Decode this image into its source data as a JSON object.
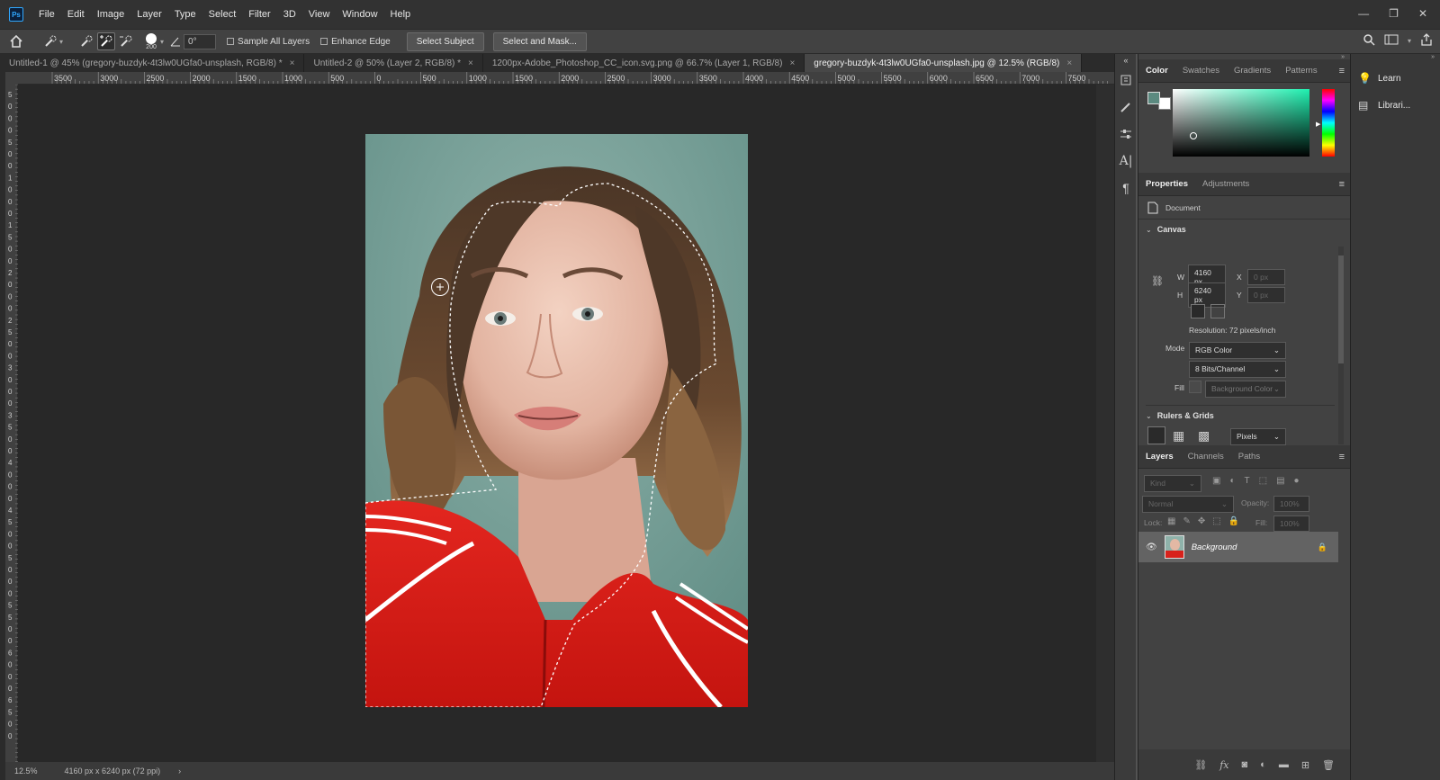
{
  "app": {
    "logo": "Ps"
  },
  "menu": [
    "File",
    "Edit",
    "Image",
    "Layer",
    "Type",
    "Select",
    "Filter",
    "3D",
    "View",
    "Window",
    "Help"
  ],
  "window_controls": {
    "minimize": "—",
    "restore": "❐",
    "close": "✕"
  },
  "options": {
    "brush_size": "200",
    "angle": "0°",
    "sample_all_layers": "Sample All Layers",
    "enhance_edge": "Enhance Edge",
    "select_subject": "Select Subject",
    "select_and_mask": "Select and Mask..."
  },
  "tabs": [
    {
      "label": "Untitled-1 @ 45% (gregory-buzdyk-4t3lw0UGfa0-unsplash, RGB/8) *",
      "close": "×"
    },
    {
      "label": "Untitled-2 @ 50% (Layer 2, RGB/8) *",
      "close": "×"
    },
    {
      "label": "1200px-Adobe_Photoshop_CC_icon.svg.png @ 66.7% (Layer 1, RGB/8)",
      "close": "×"
    },
    {
      "label": "gregory-buzdyk-4t3lw0UGfa0-unsplash.jpg @ 12.5% (RGB/8)",
      "close": "×"
    }
  ],
  "ruler": {
    "h_labels": [
      "3500",
      "3000",
      "2500",
      "2000",
      "1500",
      "1000",
      "500",
      "0",
      "500",
      "1000",
      "1500",
      "2000",
      "2500",
      "3000",
      "3500",
      "4000",
      "4500",
      "5000",
      "5500",
      "6000",
      "6500",
      "7000",
      "7500"
    ],
    "v_labels": [
      "5",
      "0",
      "0",
      "0",
      "5",
      "0",
      "0",
      "1",
      "0",
      "0",
      "0",
      "1",
      "5",
      "0",
      "0",
      "2",
      "0",
      "0",
      "0",
      "2",
      "5",
      "0",
      "0",
      "3",
      "0",
      "0",
      "0",
      "3",
      "5",
      "0",
      "0",
      "4",
      "0",
      "0",
      "0",
      "4",
      "5",
      "0",
      "0",
      "5",
      "0",
      "0",
      "0",
      "5",
      "5",
      "0",
      "0",
      "6",
      "0",
      "0",
      "0",
      "6",
      "5",
      "0",
      "0"
    ]
  },
  "status": {
    "zoom": "12.5%",
    "doc_size": "4160 px x 6240 px (72 ppi)"
  },
  "color_panel": {
    "tabs": [
      "Color",
      "Swatches",
      "Gradients",
      "Patterns"
    ],
    "active": "Color",
    "foreground": "#5c8a80",
    "background": "#ffffff"
  },
  "properties": {
    "tabs": [
      "Properties",
      "Adjustments"
    ],
    "doc_label": "Document",
    "canvas_section": "Canvas",
    "w_label": "W",
    "w_value": "4160 px",
    "h_label": "H",
    "h_value": "6240 px",
    "x_label": "X",
    "x_value": "0 px",
    "y_label": "Y",
    "y_value": "0 px",
    "resolution": "Resolution: 72 pixels/inch",
    "mode_label": "Mode",
    "mode_value": "RGB Color",
    "depth_value": "8 Bits/Channel",
    "fill_label": "Fill",
    "fill_value": "Background Color",
    "rulers_section": "Rulers & Grids",
    "units": "Pixels"
  },
  "layers": {
    "tabs": [
      "Layers",
      "Channels",
      "Paths"
    ],
    "kind": "Kind",
    "blend": "Normal",
    "opacity_label": "Opacity:",
    "opacity_value": "100%",
    "lock_label": "Lock:",
    "fill_label": "Fill:",
    "fill_value": "100%",
    "items": [
      {
        "name": "Background"
      }
    ]
  },
  "right_column": [
    {
      "label": "Learn"
    },
    {
      "label": "Librari..."
    }
  ]
}
